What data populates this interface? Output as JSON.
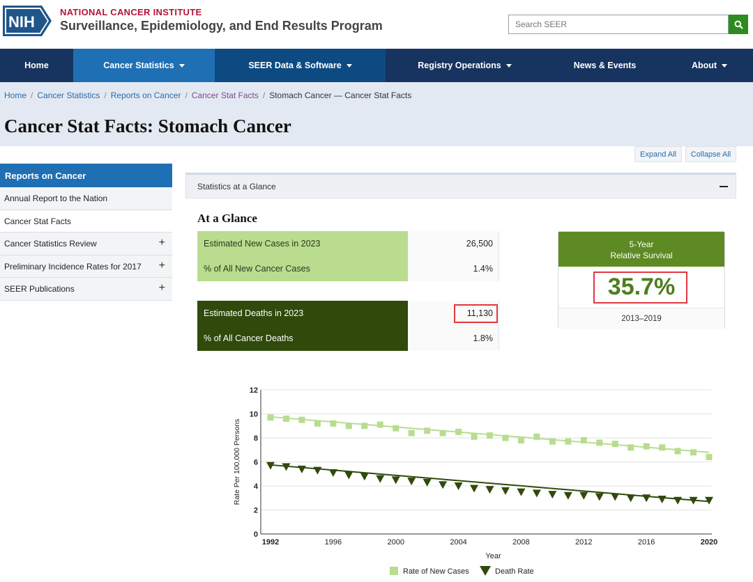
{
  "header": {
    "org_top": "NATIONAL CANCER INSTITUTE",
    "org_sub": "Surveillance, Epidemiology, and End Results Program",
    "logo_text": "NIH",
    "search_placeholder": "Search SEER"
  },
  "nav": {
    "items": [
      {
        "label": "Home",
        "caret": false
      },
      {
        "label": "Cancer Statistics",
        "caret": true
      },
      {
        "label": "SEER Data & Software",
        "caret": true
      },
      {
        "label": "Registry Operations",
        "caret": true
      },
      {
        "label": "News & Events",
        "caret": false
      },
      {
        "label": "About",
        "caret": true
      }
    ]
  },
  "breadcrumb": {
    "items": [
      "Home",
      "Cancer Statistics",
      "Reports on Cancer",
      "Cancer Stat Facts"
    ],
    "current": "Stomach Cancer — Cancer Stat Facts"
  },
  "page_title": "Cancer Stat Facts: Stomach Cancer",
  "controls": {
    "expand_all": "Expand All",
    "collapse_all": "Collapse All"
  },
  "sidebar": {
    "heading": "Reports on Cancer",
    "items": [
      {
        "label": "Annual Report to the Nation",
        "plus": ""
      },
      {
        "label": "Cancer Stat Facts",
        "plus": ""
      },
      {
        "label": "Cancer Statistics Review",
        "plus": "+"
      },
      {
        "label": "Preliminary Incidence Rates for 2017",
        "plus": "+"
      },
      {
        "label": "SEER Publications",
        "plus": "+"
      }
    ]
  },
  "accordion": {
    "label": "Statistics at a Glance"
  },
  "glance": {
    "title": "At a Glance",
    "new_cases": [
      {
        "label": "Estimated New Cases in 2023",
        "value": "26,500"
      },
      {
        "label": "% of All New Cancer Cases",
        "value": "1.4%"
      }
    ],
    "deaths": [
      {
        "label": "Estimated Deaths in 2023",
        "value": "11,130"
      },
      {
        "label": "% of All Cancer Deaths",
        "value": "1.8%"
      }
    ]
  },
  "survival": {
    "head_line1": "5-Year",
    "head_line2": "Relative Survival",
    "value": "35.7%",
    "period": "2013–2019"
  },
  "colors": {
    "nav_bg": "#17335f",
    "nav_active": "#1f6fb4",
    "new_cases": "#b9dc8f",
    "deaths": "#2f4a0b",
    "survival_head": "#5d8a23",
    "highlight": "#e0383e"
  },
  "chart_data": {
    "type": "line",
    "xlabel": "Year",
    "ylabel": "Rate Per 100,000 Persons",
    "ylim": [
      0,
      12
    ],
    "yticks": [
      0,
      2,
      4,
      6,
      8,
      10,
      12
    ],
    "xlim": [
      1992,
      2020
    ],
    "xticks": [
      1992,
      1996,
      2000,
      2004,
      2008,
      2012,
      2016,
      2020
    ],
    "grid": true,
    "legend_position": "bottom",
    "series": [
      {
        "name": "Rate of New Cases",
        "marker": "square",
        "color": "#b9dc8f",
        "x": [
          1992,
          1993,
          1994,
          1995,
          1996,
          1997,
          1998,
          1999,
          2000,
          2001,
          2002,
          2003,
          2004,
          2005,
          2006,
          2007,
          2008,
          2009,
          2010,
          2011,
          2012,
          2013,
          2014,
          2015,
          2016,
          2017,
          2018,
          2019,
          2020
        ],
        "values": [
          9.7,
          9.6,
          9.5,
          9.2,
          9.2,
          9.0,
          9.0,
          9.1,
          8.8,
          8.4,
          8.6,
          8.4,
          8.5,
          8.1,
          8.2,
          8.0,
          7.8,
          8.1,
          7.7,
          7.7,
          7.8,
          7.6,
          7.5,
          7.2,
          7.3,
          7.2,
          6.9,
          6.8,
          6.4
        ],
        "trend": [
          9.75,
          6.8
        ]
      },
      {
        "name": "Death Rate",
        "marker": "triangle-down",
        "color": "#2f4a0b",
        "x": [
          1992,
          1993,
          1994,
          1995,
          1996,
          1997,
          1998,
          1999,
          2000,
          2001,
          2002,
          2003,
          2004,
          2005,
          2006,
          2007,
          2008,
          2009,
          2010,
          2011,
          2012,
          2013,
          2014,
          2015,
          2016,
          2017,
          2018,
          2019,
          2020
        ],
        "values": [
          5.7,
          5.6,
          5.4,
          5.3,
          5.1,
          4.9,
          4.8,
          4.6,
          4.5,
          4.4,
          4.3,
          4.1,
          4.0,
          3.8,
          3.7,
          3.6,
          3.5,
          3.4,
          3.3,
          3.2,
          3.2,
          3.1,
          3.1,
          3.0,
          3.0,
          2.9,
          2.8,
          2.8,
          2.8
        ],
        "trend": [
          5.75,
          2.7
        ]
      }
    ]
  }
}
